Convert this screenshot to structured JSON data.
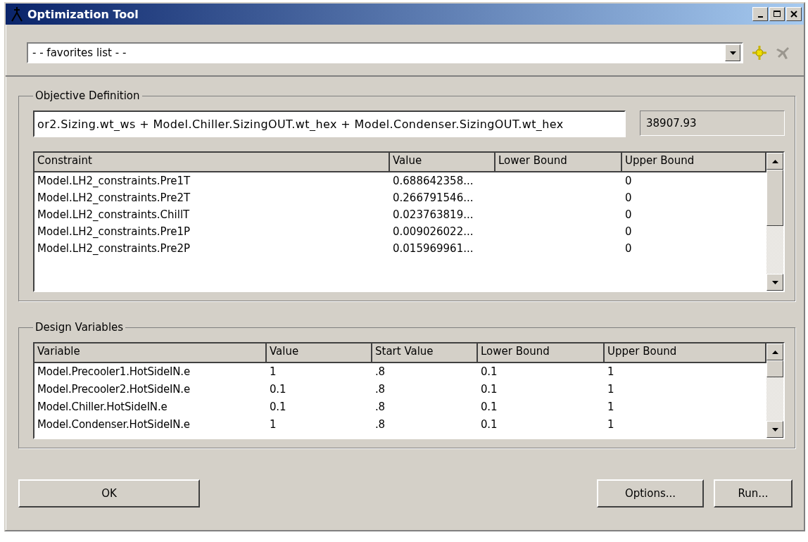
{
  "window": {
    "title": "Optimization Tool"
  },
  "favorites": {
    "value": "- -  favorites list  - -"
  },
  "objective": {
    "title": "Objective Definition",
    "expression": "or2.Sizing.wt_ws + Model.Chiller.SizingOUT.wt_hex + Model.Condenser.SizingOUT.wt_hex",
    "result": "38907.93"
  },
  "constraints": {
    "columns": [
      "Constraint",
      "Value",
      "Lower Bound",
      "Upper Bound"
    ],
    "rows": [
      [
        "Model.LH2_constraints.Pre1T",
        "0.688642358...",
        "",
        "0"
      ],
      [
        "Model.LH2_constraints.Pre2T",
        "0.266791546...",
        "",
        "0"
      ],
      [
        "Model.LH2_constraints.ChillT",
        "0.023763819...",
        "",
        "0"
      ],
      [
        "Model.LH2_constraints.Pre1P",
        "0.009026022...",
        "",
        "0"
      ],
      [
        "Model.LH2_constraints.Pre2P",
        "0.015969961...",
        "",
        "0"
      ]
    ]
  },
  "design_variables": {
    "title": "Design Variables",
    "columns": [
      "Variable",
      "Value",
      "Start Value",
      "Lower Bound",
      "Upper Bound"
    ],
    "rows": [
      [
        "Model.Precooler1.HotSideIN.e",
        "1",
        ".8",
        "0.1",
        "1"
      ],
      [
        "Model.Precooler2.HotSideIN.e",
        "0.1",
        ".8",
        "0.1",
        "1"
      ],
      [
        "Model.Chiller.HotSideIN.e",
        "0.1",
        ".8",
        "0.1",
        "1"
      ],
      [
        "Model.Condenser.HotSideIN.e",
        "1",
        ".8",
        "0.1",
        "1"
      ]
    ]
  },
  "buttons": {
    "ok": "OK",
    "options": "Options...",
    "run": "Run..."
  }
}
